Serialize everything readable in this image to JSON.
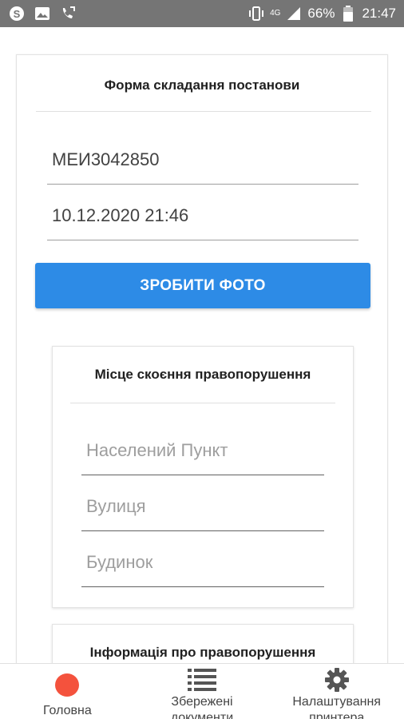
{
  "status_bar": {
    "left_icons": [
      "skype-icon",
      "image-icon",
      "call-forward-icon"
    ],
    "network": "4G",
    "battery": "66%",
    "time": "21:47"
  },
  "form": {
    "title": "Форма складання постанови",
    "id_value": "МЕИ3042850",
    "datetime_value": "10.12.2020 21:46",
    "photo_button": "ЗРОБИТИ ФОТО"
  },
  "place": {
    "title": "Місце скоєння правопорушення",
    "settlement_placeholder": "Населений Пункт",
    "street_placeholder": "Вулиця",
    "house_placeholder": "Будинок"
  },
  "info": {
    "title": "Інформація про правопорушення"
  },
  "bottom_nav": {
    "home": "Головна",
    "saved_line1": "Збережені",
    "saved_line2": "документи",
    "printer_line1": "Налаштування",
    "printer_line2": "принтера"
  },
  "colors": {
    "status_bar": "#757575",
    "primary": "#2d8be6",
    "home_accent": "#f4523d"
  }
}
